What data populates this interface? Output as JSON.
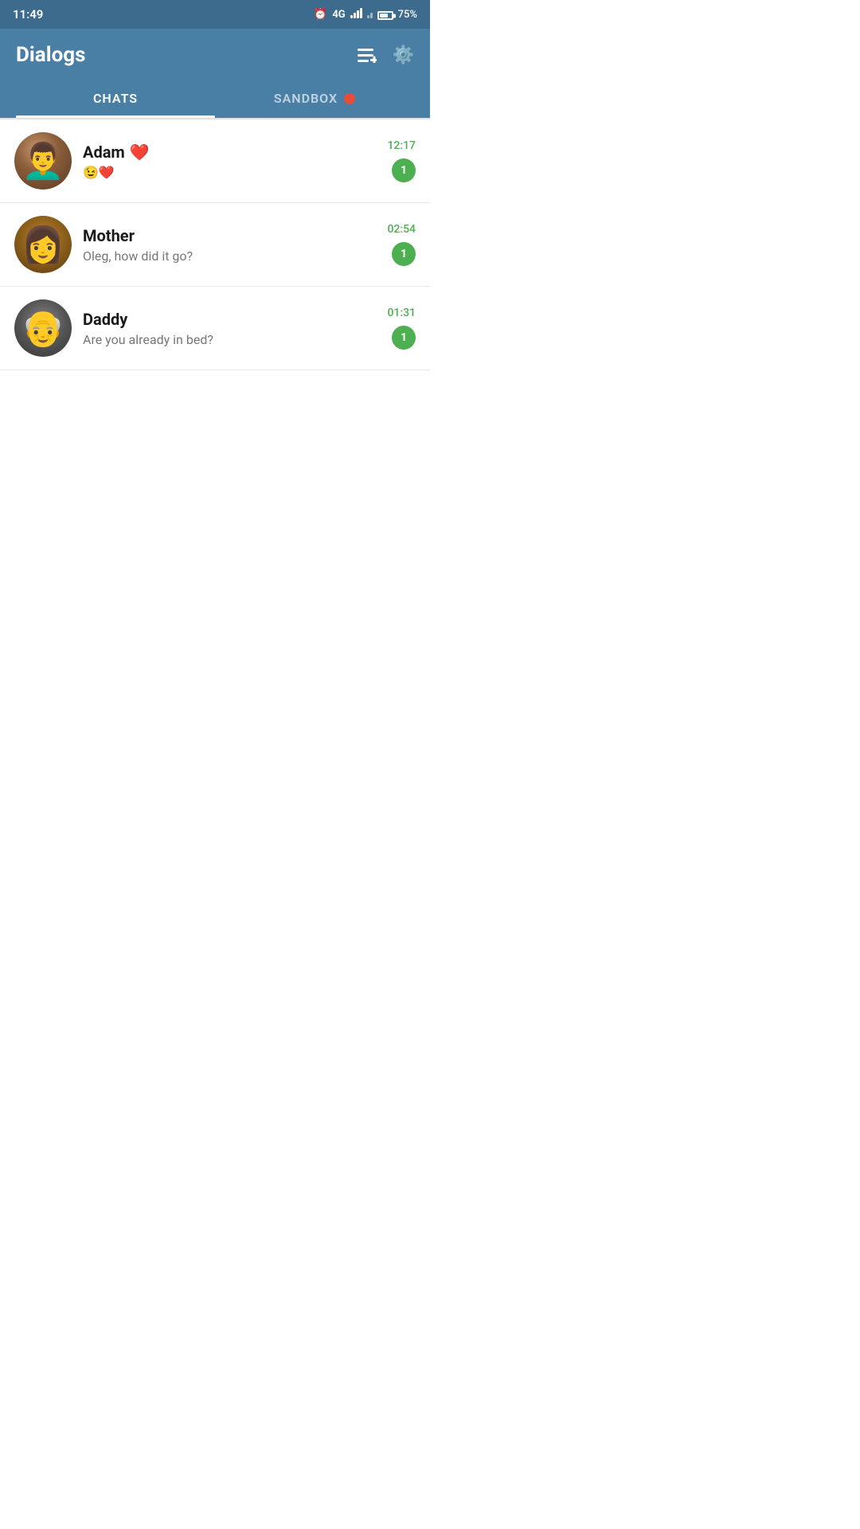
{
  "statusBar": {
    "time": "11:49",
    "network": "4G",
    "battery": "75%"
  },
  "header": {
    "title": "Dialogs",
    "composeLabel": "compose",
    "settingsLabel": "settings"
  },
  "tabs": [
    {
      "id": "chats",
      "label": "CHATS",
      "active": true
    },
    {
      "id": "sandbox",
      "label": "SANDBOX",
      "active": false
    }
  ],
  "chats": [
    {
      "id": "adam",
      "name": "Adam",
      "nameEmoji": "❤️",
      "lastMessage": "😉❤️",
      "time": "12:17",
      "unread": 1
    },
    {
      "id": "mother",
      "name": "Mother",
      "lastMessage": "Oleg, how did it go?",
      "time": "02:54",
      "unread": 1
    },
    {
      "id": "daddy",
      "name": "Daddy",
      "lastMessage": "Are you already in bed?",
      "time": "01:31",
      "unread": 1
    }
  ]
}
